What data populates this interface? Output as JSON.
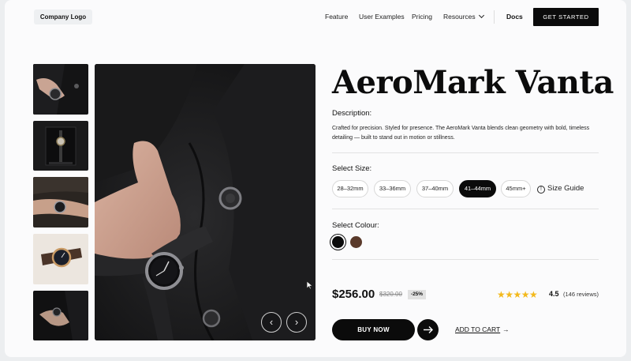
{
  "nav": {
    "logo": "Company Logo",
    "links": [
      "Feature",
      "User Examples",
      "Pricing",
      "Resources"
    ],
    "docs": "Docs",
    "cta": "GET STARTED"
  },
  "gallery": {
    "thumbnail_count": 5,
    "selected_index": 0,
    "prev_label": "‹",
    "next_label": "›"
  },
  "product": {
    "title": "AeroMark Vanta",
    "description_label": "Description:",
    "description": "Crafted for precision. Styled for presence. The AeroMark Vanta blends clean geometry with bold, timeless detailing — built to stand out in motion or stillness.",
    "size_label": "Select Size:",
    "sizes": [
      "28–32mm",
      "33–36mm",
      "37–40mm",
      "41–44mm",
      "45mm+"
    ],
    "selected_size": "41–44mm",
    "size_guide": "Size Guide",
    "size_guide_icon": "!",
    "colour_label": "Select Colour:",
    "colours": [
      {
        "name": "black",
        "hex": "#0b0b0b"
      },
      {
        "name": "brown",
        "hex": "#5a3a2b"
      }
    ],
    "selected_colour": "black",
    "price": "$256.00",
    "old_price": "$320.00",
    "discount": "-25%",
    "stars": "★★★★★",
    "rating": "4.5",
    "reviews": "(146 reviews)",
    "buy_now": "BUY NOW",
    "add_to_cart": "ADD TO CART",
    "add_to_cart_arrow": "→"
  },
  "colors": {
    "accent": "#0b0b0b",
    "star": "#f3b91c",
    "background": "#fbfbfc"
  }
}
